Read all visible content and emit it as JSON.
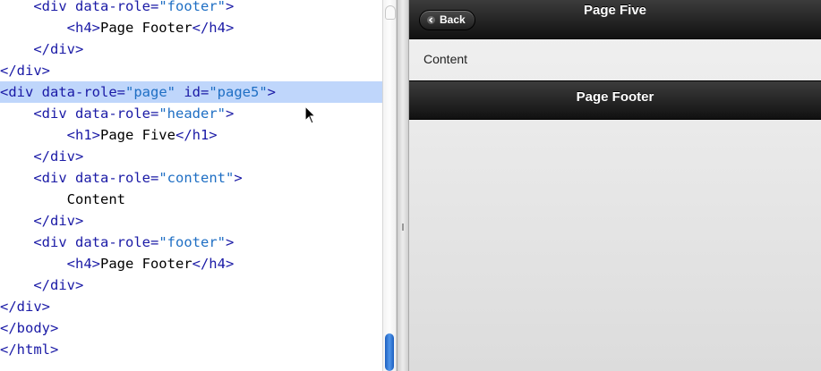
{
  "editor": {
    "lines": [
      {
        "indent": "    ",
        "tag_open": "<div ",
        "attr": "data-role=",
        "str": "\"footer\"",
        "tag_close": ">",
        "text": ""
      },
      {
        "indent": "        ",
        "tag_open": "<h4>",
        "attr": "",
        "str": "",
        "tag_close": "</h4>",
        "text": "Page Footer"
      },
      {
        "indent": "    ",
        "tag_open": "</div>",
        "attr": "",
        "str": "",
        "tag_close": "",
        "text": ""
      },
      {
        "indent": "",
        "tag_open": "</div>",
        "attr": "",
        "str": "",
        "tag_close": "",
        "text": ""
      },
      {
        "indent": "",
        "tag_open": "<div ",
        "attr": "data-role=",
        "str": "\"page\"",
        "attr2": " id=",
        "str2": "\"page5\"",
        "tag_close": ">",
        "text": "",
        "highlight": true
      },
      {
        "indent": "    ",
        "tag_open": "<div ",
        "attr": "data-role=",
        "str": "\"header\"",
        "tag_close": ">",
        "text": ""
      },
      {
        "indent": "        ",
        "tag_open": "<h1>",
        "attr": "",
        "str": "",
        "tag_close": "</h1>",
        "text": "Page Five"
      },
      {
        "indent": "    ",
        "tag_open": "</div>",
        "attr": "",
        "str": "",
        "tag_close": "",
        "text": ""
      },
      {
        "indent": "    ",
        "tag_open": "<div ",
        "attr": "data-role=",
        "str": "\"content\"",
        "tag_close": ">",
        "text": ""
      },
      {
        "indent": "        ",
        "tag_open": "",
        "attr": "",
        "str": "",
        "tag_close": "",
        "text": "Content"
      },
      {
        "indent": "    ",
        "tag_open": "</div>",
        "attr": "",
        "str": "",
        "tag_close": "",
        "text": ""
      },
      {
        "indent": "    ",
        "tag_open": "<div ",
        "attr": "data-role=",
        "str": "\"footer\"",
        "tag_close": ">",
        "text": ""
      },
      {
        "indent": "        ",
        "tag_open": "<h4>",
        "attr": "",
        "str": "",
        "tag_close": "</h4>",
        "text": "Page Footer"
      },
      {
        "indent": "    ",
        "tag_open": "</div>",
        "attr": "",
        "str": "",
        "tag_close": "",
        "text": ""
      },
      {
        "indent": "",
        "tag_open": "</div>",
        "attr": "",
        "str": "",
        "tag_close": "",
        "text": ""
      },
      {
        "indent": "",
        "tag_open": "</body>",
        "attr": "",
        "str": "",
        "tag_close": "",
        "text": ""
      },
      {
        "indent": "",
        "tag_open": "</html>",
        "attr": "",
        "str": "",
        "tag_close": "",
        "text": ""
      }
    ],
    "cursor_icon": "mouse-pointer-icon",
    "colors": {
      "tag": "#1a1aa6",
      "string": "#1f6fc4",
      "highlight": "#bfd6fb"
    }
  },
  "preview": {
    "header": {
      "title": "Page Five",
      "back_label": "Back",
      "back_icon": "chevron-left-icon"
    },
    "content": {
      "text": "Content"
    },
    "footer": {
      "title": "Page Footer"
    }
  }
}
